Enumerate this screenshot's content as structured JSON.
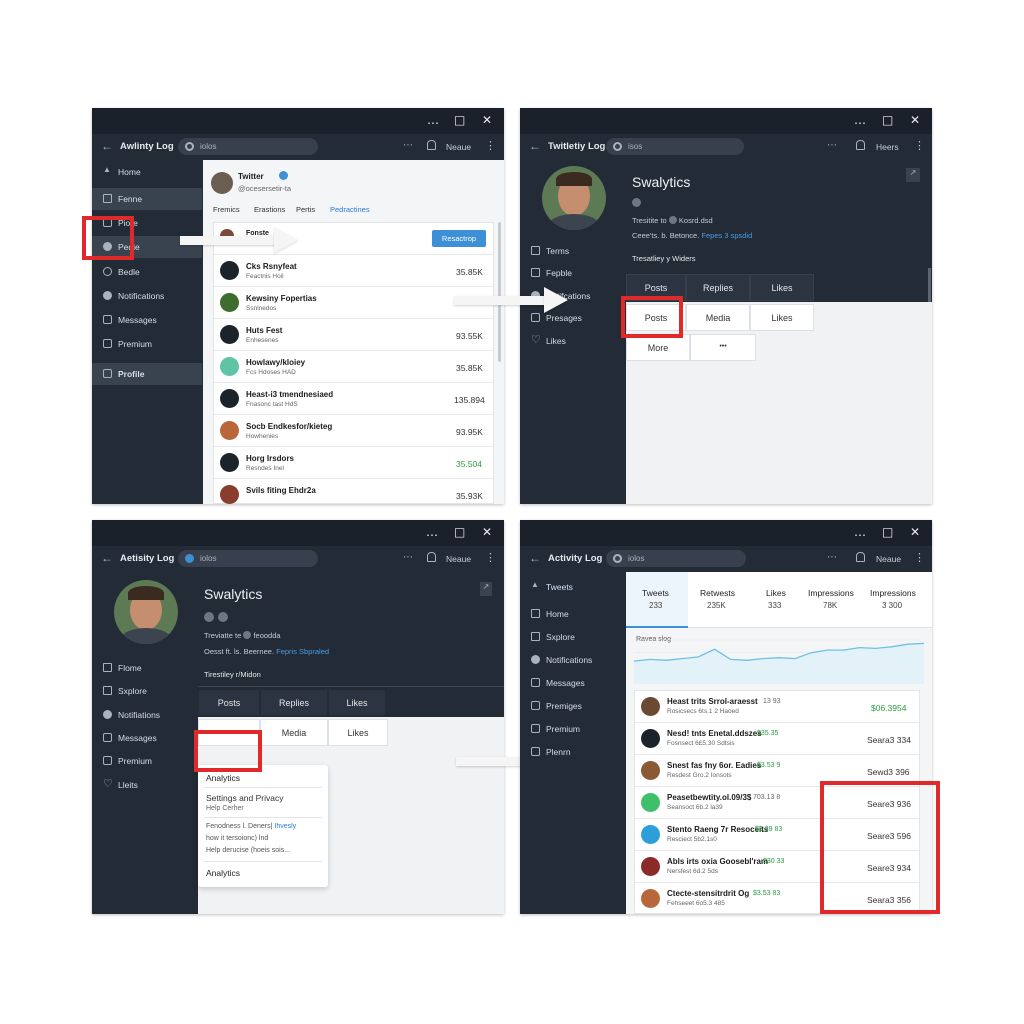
{
  "colors": {
    "panel_dark": "#222b36",
    "accent_blue": "#3d8fd6",
    "highlight_red": "#e0292b",
    "positive_green": "#2a9d3f"
  },
  "window_controls": {
    "minimize": "…",
    "maximize": "□",
    "close": "✕"
  },
  "panel1": {
    "title": "Awlinty Log",
    "search": "iolos",
    "more_icon": "⋯",
    "name": "Neaue",
    "nav": [
      "Home",
      "Fenne",
      "Piore",
      "Pedie",
      "Bedle",
      "Notifications",
      "Messages",
      "Premium",
      "Profile"
    ],
    "account": {
      "name": "Twitter",
      "handle": "@ocesersetir-ta"
    },
    "tabs": [
      "Fremics",
      "Erastions",
      "Pertis",
      "Pedractines"
    ],
    "action": "Resactrop",
    "rows": [
      {
        "title": "Fonste",
        "sub": "",
        "value": ""
      },
      {
        "title": "Cks Rsnyfeat",
        "sub": "Feactnis Hoil",
        "value": "35.85K"
      },
      {
        "title": "Kewsiny Fopertias",
        "sub": "Ssnlnedos",
        "value": ""
      },
      {
        "title": "Huts Fest",
        "sub": "Enhesenes",
        "value": "93.55K"
      },
      {
        "title": "Howlawy/kloiey",
        "sub": "Fcs Hdoses HAD",
        "value": "35.85K"
      },
      {
        "title": "Heast-i3 tmendnesiaed",
        "sub": "Fnasonc tast HdS",
        "value": "135.894"
      },
      {
        "title": "Socb Endkesfor/kieteg",
        "sub": "Howhenies",
        "value": "93.95K"
      },
      {
        "title": "Horg Irsdors",
        "sub": "Resndes Inel",
        "value": "35.504"
      },
      {
        "title": "Svils fiting Ehdr2a",
        "sub": "",
        "value": "35.93K"
      }
    ]
  },
  "panel2": {
    "title": "Twitletiy Log",
    "search": "isos",
    "name": "Heers",
    "profile_name": "Swalytics",
    "line1": "Tresitite to",
    "line1b": "Kosrd.dsd",
    "line2": "Ceee'ts. b. Betonce.",
    "line2_link": "Fepes 3 spsdid",
    "section": "Tresatliey y Widers",
    "nav": [
      "Terms",
      "Fepble",
      "Notifcations",
      "Presages",
      "Likes"
    ],
    "buttons_row1": [
      "Posts",
      "Replies",
      "Likes"
    ],
    "buttons_row2": [
      "Posts",
      "Media",
      "Likes"
    ],
    "buttons_row3": [
      "More",
      "•••"
    ]
  },
  "panel3": {
    "title": "Aetisity Log",
    "search": "iolos",
    "name": "Neaue",
    "profile_name": "Swalytics",
    "line1": "Treviatte te",
    "line1b": "feoodda",
    "line2": "Oesst ft. ls. Beernee.",
    "line2_link": "Fepris Sbpraled",
    "section": "Tirestiley r/Midon",
    "nav": [
      "Flome",
      "Sxplore",
      "Notifiations",
      "Messages",
      "Premium",
      "Lleits"
    ],
    "buttons_row1": [
      "Posts",
      "Replies",
      "Likes"
    ],
    "buttons_row2": [
      "Media",
      "Likes"
    ],
    "menu": {
      "title": "Analytics",
      "item1": "Settings and Privacy",
      "item1_sub": "Help Cerher",
      "item2": "Fenodness l. Deners|",
      "item2_link": "Ihvesly",
      "item2_sub": "how it tersoionc) lnd",
      "item2_sub2": "Help derucise (hoeis sois...",
      "footer": "Analytics"
    }
  },
  "panel4": {
    "title": "Activity Log",
    "search": "iolos",
    "name": "Neaue",
    "nav": [
      "Tweets",
      "Home",
      "Sxplore",
      "Notifications",
      "Messages",
      "Premiges",
      "Premium",
      "Plenrn"
    ],
    "stats": [
      {
        "label": "Tweets",
        "value": "233"
      },
      {
        "label": "Retwests",
        "value": "235K"
      },
      {
        "label": "Likes",
        "value": "333"
      },
      {
        "label": "Impressions",
        "value": "78K"
      },
      {
        "label": "Impressions",
        "value": "3 300"
      }
    ],
    "chart_title": "Ravea slog",
    "chart_data": {
      "type": "line",
      "title": "Ravea slog",
      "xlabel": "",
      "ylabel": "",
      "series": [
        {
          "values": [
            20,
            22,
            21,
            23,
            25,
            34,
            22,
            21,
            23,
            24,
            23,
            30,
            33,
            33,
            36,
            35,
            37,
            40,
            41
          ]
        }
      ],
      "grid": true
    },
    "rows": [
      {
        "title": "Heast trits Srrol-araesst",
        "mid": "13 93",
        "sub": "Rosicsecs 6ts.1 2 Haoed",
        "value": "$06.3954"
      },
      {
        "title": "Nesd! tnts Enetal.ddszes",
        "mid": "$35.35",
        "sub": "Fosnsect 6£5.30 Sdtsis",
        "value": "Seara3 334"
      },
      {
        "title": "Snest fas fny 6or. Eadies",
        "mid": "$3.53 9",
        "sub": "Resdest Gro.2 Ionsots",
        "value": "Sewd3 396"
      },
      {
        "title": "Peasetbewtity.ol.09/3$",
        "mid": "703.13 8",
        "sub": "Seansoct 6b.2 la39",
        "value": "Seare3 936"
      },
      {
        "title": "Stento Raeng 7r Resoceits",
        "mid": "$3.39 83",
        "sub": "Resciect 5b2.1s0",
        "value": "Seare3 596"
      },
      {
        "title": "Abls irts oxia Goosebl'ram",
        "mid": "$30 33",
        "sub": "Nersfest 6d.2 5ds",
        "value": "Seare3 934"
      },
      {
        "title": "Ctecte-stensitrdrit Og",
        "mid": "$3.53 83",
        "sub": "Fehseeet 6o5.3 485",
        "value": "Seara3 356"
      }
    ]
  }
}
